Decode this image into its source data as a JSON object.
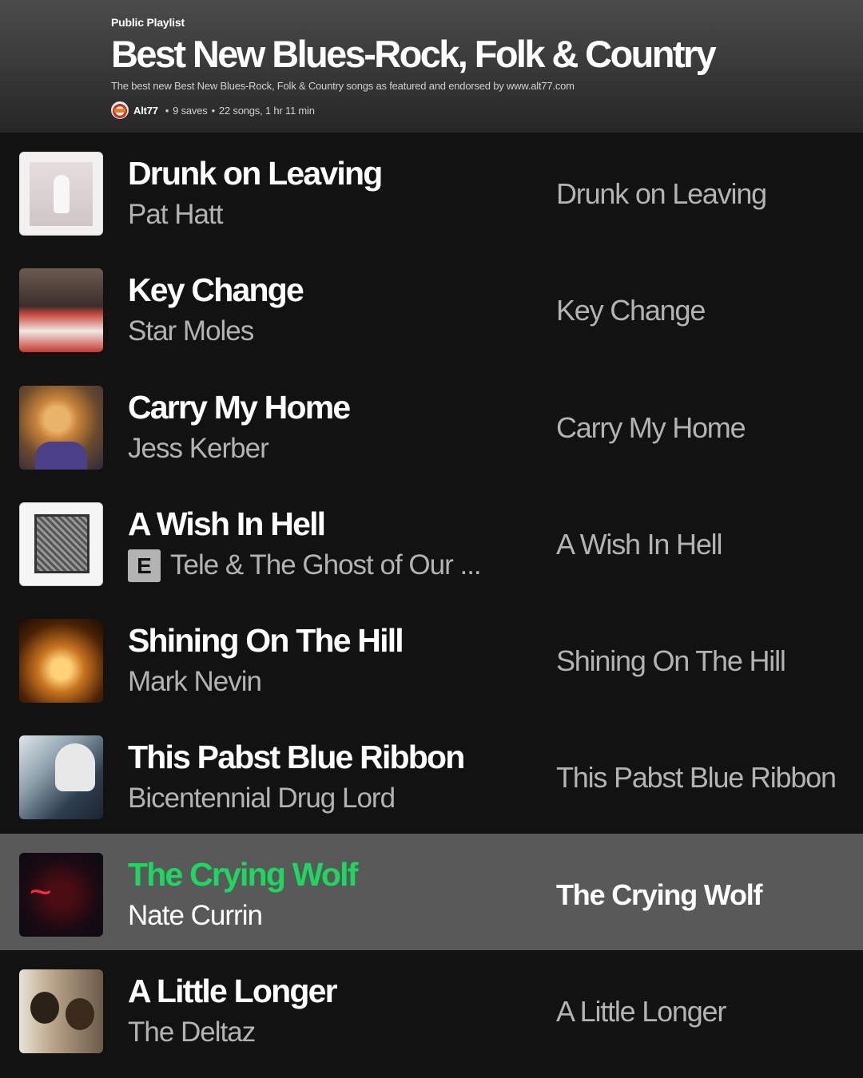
{
  "playlist": {
    "type_label": "Public Playlist",
    "title": "Best New Blues-Rock, Folk & Country",
    "description": "The best new Best New Blues-Rock, Folk & Country songs as featured and endorsed by www.alt77.com",
    "owner": "Alt77",
    "saves": "9 saves",
    "summary": "22 songs, 1 hr 11 min",
    "separator": "•"
  },
  "tracks": [
    {
      "title": "Drunk on Leaving",
      "artist": "Pat Hatt",
      "album": "Drunk on Leaving",
      "explicit": false
    },
    {
      "title": "Key Change",
      "artist": "Star Moles",
      "album": "Key Change",
      "explicit": false
    },
    {
      "title": "Carry My Home",
      "artist": "Jess Kerber",
      "album": "Carry My Home",
      "explicit": false
    },
    {
      "title": "A Wish In Hell",
      "artist": "Tele & The Ghost of Our ...",
      "album": "A Wish In Hell",
      "explicit": true,
      "explicit_label": "E"
    },
    {
      "title": "Shining On The Hill",
      "artist": "Mark Nevin",
      "album": "Shining On The Hill",
      "explicit": false
    },
    {
      "title": "This Pabst Blue Ribbon",
      "artist": "Bicentennial Drug Lord",
      "album": "This Pabst Blue Ribbon",
      "explicit": false
    },
    {
      "title": "The Crying Wolf",
      "artist": "Nate Currin",
      "album": "The Crying Wolf",
      "explicit": false,
      "active": true
    },
    {
      "title": "A Little Longer",
      "artist": "The Deltaz",
      "album": "A Little Longer",
      "explicit": false
    }
  ],
  "colors": {
    "background": "#121212",
    "active_row": "#595959",
    "active_title": "#1ed760",
    "secondary_text": "#b3b3b3"
  }
}
